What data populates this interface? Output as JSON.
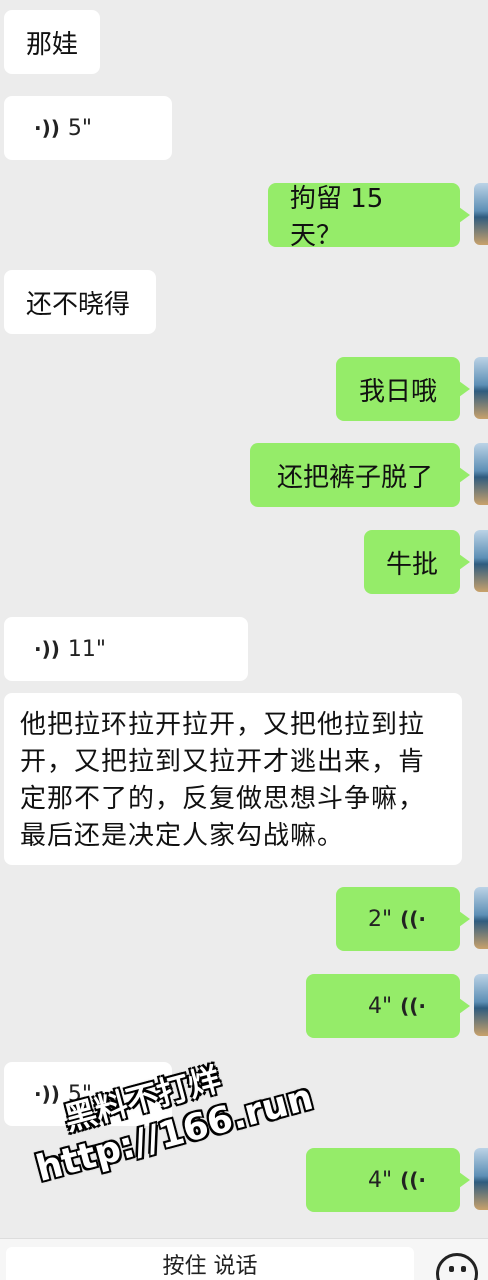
{
  "messages": [
    {
      "side": "in",
      "type": "text",
      "text": "那娃"
    },
    {
      "side": "in",
      "type": "voice",
      "duration": "5\""
    },
    {
      "side": "out",
      "type": "text",
      "text": "拘留 15 天？"
    },
    {
      "side": "in",
      "type": "text",
      "text": "还不晓得"
    },
    {
      "side": "out",
      "type": "text",
      "text": "我日哦"
    },
    {
      "side": "out",
      "type": "text",
      "text": "还把裤子脱了"
    },
    {
      "side": "out",
      "type": "text",
      "text": "牛批"
    },
    {
      "side": "in",
      "type": "voice",
      "duration": "11\""
    },
    {
      "side": "in",
      "type": "text",
      "text": "他把拉环拉开拉开，又把他拉到拉开，又把拉到又拉开才逃出来，肯定那不了的，反复做思想斗争嘛，最后还是决定人家勾战嘛。"
    },
    {
      "side": "out",
      "type": "voice",
      "duration": "2\""
    },
    {
      "side": "out",
      "type": "voice",
      "duration": "4\""
    },
    {
      "side": "in",
      "type": "voice",
      "duration": "5\""
    },
    {
      "side": "out",
      "type": "voice",
      "duration": "4\""
    }
  ],
  "long_lines": [
    "他把拉环拉开拉开，又把他拉到拉",
    "开，又把拉到又拉开才逃出来，肯",
    "定那不了的，反复做思想斗争嘛，",
    "最后还是决定人家勾战嘛。"
  ],
  "voice_icon_in": "·))",
  "voice_icon_out": "((·",
  "watermark": {
    "line1": "黑料不打烊",
    "line2": "http://166.run"
  },
  "input_bar": {
    "hold_to_talk": "按住 说话",
    "emoji_icon": "smiley-face-icon"
  },
  "colors": {
    "background": "#ececec",
    "incoming": "#ffffff",
    "outgoing": "#95ec69"
  }
}
